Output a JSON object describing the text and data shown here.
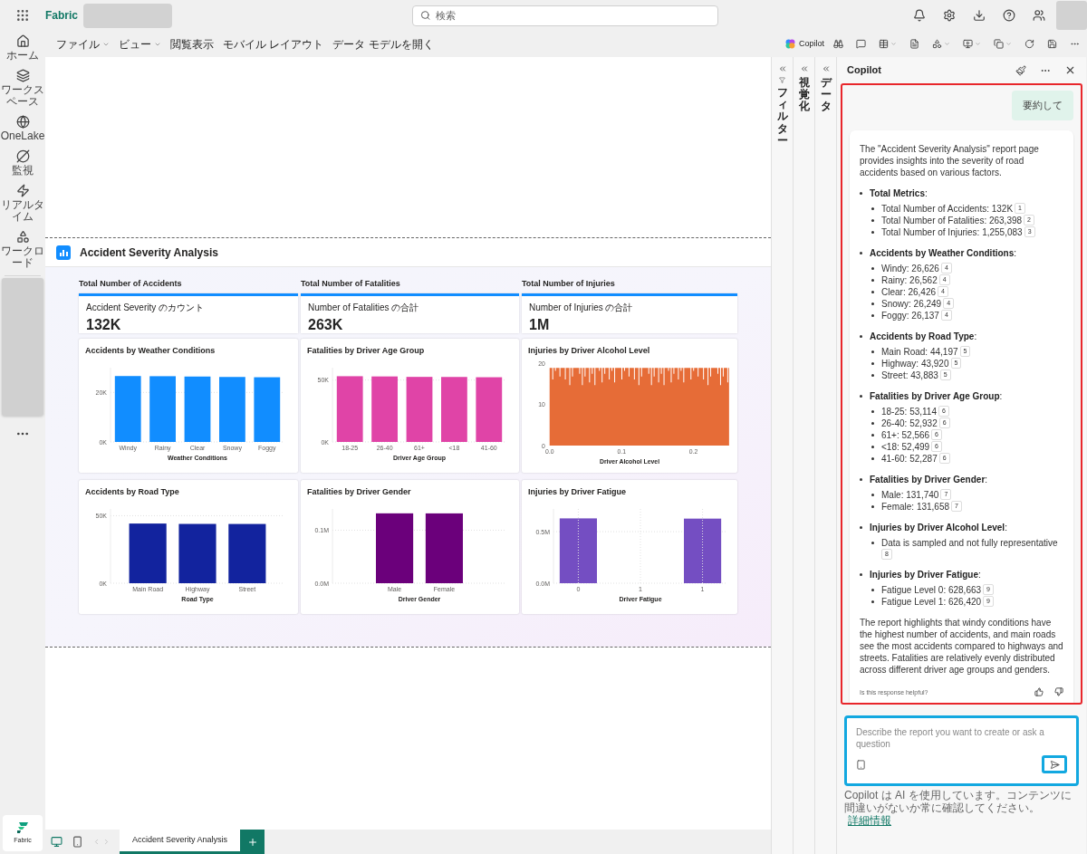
{
  "top_bar": {
    "app_name": "Fabric",
    "search": {
      "placeholder": "検索"
    }
  },
  "left_nav": {
    "items": [
      {
        "label": "ホーム"
      },
      {
        "label": "ワークスペース"
      },
      {
        "label": "OneLake"
      },
      {
        "label": "監視"
      },
      {
        "label": "リアルタイム"
      },
      {
        "label": "ワークロード"
      }
    ],
    "bottom_label": "Fabric"
  },
  "ribbon": {
    "menus": [
      {
        "label": "ファイル",
        "dropdown": true
      },
      {
        "label": "ビュー",
        "dropdown": true
      },
      {
        "label": "閲覧表示",
        "dropdown": false
      },
      {
        "label": "モバイル レイアウト",
        "dropdown": false
      },
      {
        "label": "データ モデルを開く",
        "dropdown": false
      }
    ],
    "copilot_button": "Copilot"
  },
  "report": {
    "title": "Accident Severity Analysis",
    "kpis": [
      {
        "group_title": "Total Number of Accidents",
        "label": "Accident Severity のカウント",
        "value": "132K"
      },
      {
        "group_title": "Total Number of Fatalities",
        "label": "Number of Fatalities の合計",
        "value": "263K"
      },
      {
        "group_title": "Total Number of Injuries",
        "label": "Number of Injuries の合計",
        "value": "1M"
      }
    ],
    "charts": [
      {
        "kind": "bar",
        "chart_data": {
          "type": "bar",
          "title": "Accidents by Weather Conditions",
          "xlabel": "Weather Conditions",
          "categories": [
            "Windy",
            "Rainy",
            "Clear",
            "Snowy",
            "Foggy"
          ],
          "series": [
            {
              "color": "#118dff",
              "values": [
                26626,
                26562,
                26426,
                26249,
                26137
              ]
            }
          ],
          "ylim": [
            0,
            30000
          ],
          "yticks": [
            {
              "value": 0,
              "label": "0K"
            },
            {
              "value": 20000,
              "label": "20K"
            }
          ]
        }
      },
      {
        "kind": "bar",
        "chart_data": {
          "type": "bar",
          "title": "Fatalities by Driver Age Group",
          "xlabel": "Driver Age Group",
          "categories": [
            "18-25",
            "26-40",
            "61+",
            "<18",
            "41-60"
          ],
          "series": [
            {
              "color": "#e044a7",
              "values": [
                53114,
                52932,
                52566,
                52499,
                52287
              ]
            }
          ],
          "ylim": [
            0,
            60000
          ],
          "yticks": [
            {
              "value": 0,
              "label": "0K"
            },
            {
              "value": 50000,
              "label": "50K"
            }
          ]
        }
      },
      {
        "kind": "histogram",
        "title": "Injuries by Driver Alcohol Level",
        "xlabel": "Driver Alcohol Level",
        "color": "#e66c37",
        "yticks": [
          "20",
          "10",
          "0"
        ],
        "xticks": [
          "0.0",
          "0.1",
          "0.2"
        ]
      },
      {
        "kind": "bar",
        "chart_data": {
          "type": "bar",
          "title": "Accidents by Road Type",
          "xlabel": "Road Type",
          "categories": [
            "Main Road",
            "Highway",
            "Street"
          ],
          "series": [
            {
              "color": "#12239e",
              "values": [
                44197,
                43920,
                43883
              ]
            }
          ],
          "ylim": [
            0,
            55000
          ],
          "yticks": [
            {
              "value": 0,
              "label": "0K"
            },
            {
              "value": 50000,
              "label": "50K"
            }
          ]
        }
      },
      {
        "kind": "bar",
        "chart_data": {
          "type": "bar",
          "title": "Fatalities by Driver Gender",
          "xlabel": "Driver Gender",
          "categories": [
            "Male",
            "Female"
          ],
          "series": [
            {
              "color": "#6b007b",
              "values": [
                131740,
                131658
              ]
            }
          ],
          "ylim": [
            0,
            140000
          ],
          "yticks": [
            {
              "value": 0,
              "label": "0.0M"
            },
            {
              "value": 100000,
              "label": "0.1M"
            }
          ]
        }
      },
      {
        "kind": "bar",
        "chart_data": {
          "type": "bar",
          "title": "Injuries by Driver Fatigue",
          "xlabel": "Driver Fatigue",
          "x": [
            0,
            1
          ],
          "series": [
            {
              "color": "#744ec2",
              "values": [
                628663,
                626420
              ]
            }
          ],
          "xlim": [
            -0.2,
            1.2
          ],
          "ylim": [
            0,
            720000
          ],
          "grid": true,
          "xticks": [
            {
              "value": 0,
              "label": "0"
            },
            {
              "value": 0.5,
              "label": "1"
            },
            {
              "value": 1,
              "label": "1"
            }
          ],
          "yticks": [
            {
              "value": 0,
              "label": "0.0M"
            },
            {
              "value": 500000,
              "label": "0.5M"
            }
          ]
        }
      }
    ]
  },
  "side_panes": [
    {
      "label": "フィルター"
    },
    {
      "label": "視覚化"
    },
    {
      "label": "データ"
    }
  ],
  "copilot": {
    "title": "Copilot",
    "user_message": "要約して",
    "response": {
      "intro": "The \"Accident Severity Analysis\" report page provides insights into the severity of road accidents based on various factors.",
      "sections": [
        {
          "heading": "**Total Metrics**:",
          "items": [
            {
              "text": "Total Number of Accidents: 132K",
              "ref": "1"
            },
            {
              "text": "Total Number of Fatalities: 263,398",
              "ref": "2"
            },
            {
              "text": "Total Number of Injuries: 1,255,083",
              "ref": "3"
            }
          ]
        },
        {
          "heading": "**Accidents by Weather Conditions**:",
          "items": [
            {
              "text": "Windy: 26,626",
              "ref": "4"
            },
            {
              "text": "Rainy: 26,562",
              "ref": "4"
            },
            {
              "text": "Clear: 26,426",
              "ref": "4"
            },
            {
              "text": "Snowy: 26,249",
              "ref": "4"
            },
            {
              "text": "Foggy: 26,137",
              "ref": "4"
            }
          ]
        },
        {
          "heading": "**Accidents by Road Type**:",
          "items": [
            {
              "text": "Main Road: 44,197",
              "ref": "5"
            },
            {
              "text": "Highway: 43,920",
              "ref": "5"
            },
            {
              "text": "Street: 43,883",
              "ref": "5"
            }
          ]
        },
        {
          "heading": "**Fatalities by Driver Age Group**:",
          "items": [
            {
              "text": "18-25: 53,114",
              "ref": "6"
            },
            {
              "text": "26-40: 52,932",
              "ref": "6"
            },
            {
              "text": "61+: 52,566",
              "ref": "6"
            },
            {
              "text": "<18: 52,499",
              "ref": "6"
            },
            {
              "text": "41-60: 52,287",
              "ref": "6"
            }
          ]
        },
        {
          "heading": "**Fatalities by Driver Gender**:",
          "items": [
            {
              "text": "Male: 131,740",
              "ref": "7"
            },
            {
              "text": "Female: 131,658",
              "ref": "7"
            }
          ]
        },
        {
          "heading": "**Injuries by Driver Alcohol Level**:",
          "items": [
            {
              "text": "Data is sampled and not fully representative",
              "ref": "8"
            }
          ]
        },
        {
          "heading": "**Injuries by Driver Fatigue**:",
          "items": [
            {
              "text": "Fatigue Level 0: 628,663",
              "ref": "9"
            },
            {
              "text": "Fatigue Level 1: 626,420",
              "ref": "9"
            }
          ]
        }
      ],
      "conclusion": "The report highlights that windy conditions have the highest number of accidents, and main roads see the most accidents compared to highways and streets. Fatalities are relatively evenly distributed across different driver age groups and genders.",
      "feedback_prompt": "Is this response helpful?"
    },
    "input": {
      "placeholder": "Describe the report you want to create or ask a question"
    },
    "disclaimer": "Copilot は AI を使用しています。コンテンツに間違いがないか常に確認してください。",
    "disclaimer_link": "詳細情報"
  },
  "page_tabs": [
    {
      "label": "Accident Severity Analysis",
      "selected": true
    }
  ]
}
